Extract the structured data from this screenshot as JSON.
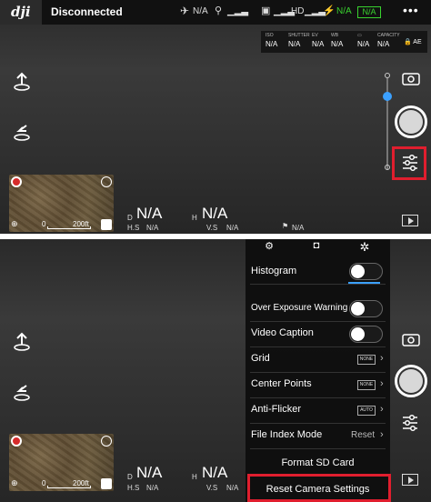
{
  "status": {
    "brand": "dji",
    "connection": "Disconnected",
    "aircraft_signal": "N/A",
    "remote_hd": "HD",
    "battery": "N/A",
    "battery_badge": "N/A",
    "more": "•••"
  },
  "camera_params": [
    {
      "label": "ISO",
      "value": "N/A"
    },
    {
      "label": "SHUTTER",
      "value": "N/A"
    },
    {
      "label": "EV",
      "value": "N/A"
    },
    {
      "label": "WB",
      "value": "N/A"
    },
    {
      "label": "",
      "value": "N/A"
    },
    {
      "label": "CAPACITY",
      "value": "N/A"
    },
    {
      "label": "",
      "value": "AE"
    }
  ],
  "map": {
    "scale_start": "0",
    "scale_end": "200ft"
  },
  "telemetry": {
    "d_label": "D",
    "d_value": "N/A",
    "h_label": "H",
    "h_value": "N/A",
    "hs_label": "H.S",
    "hs_value": "N/A",
    "vs_label": "V.S",
    "vs_value": "N/A",
    "vps_value": "N/A"
  },
  "settings_menu": {
    "items": [
      {
        "label": "Histogram",
        "control": "toggle"
      },
      {
        "label": "Over Exposure Warning",
        "control": "toggle"
      },
      {
        "label": "Video Caption",
        "control": "toggle"
      },
      {
        "label": "Grid",
        "control": "badge",
        "badge": "NONE"
      },
      {
        "label": "Center Points",
        "control": "badge",
        "badge": "NONE"
      },
      {
        "label": "Anti-Flicker",
        "control": "badge",
        "badge": "AUTO"
      },
      {
        "label": "File Index Mode",
        "control": "value",
        "value": "Reset"
      }
    ],
    "format_sd": "Format SD Card",
    "reset_camera": "Reset Camera Settings"
  },
  "colors": {
    "accent_blue": "#3ba0ff",
    "highlight_red": "#e01e2e",
    "signal_green": "#39d22f"
  }
}
